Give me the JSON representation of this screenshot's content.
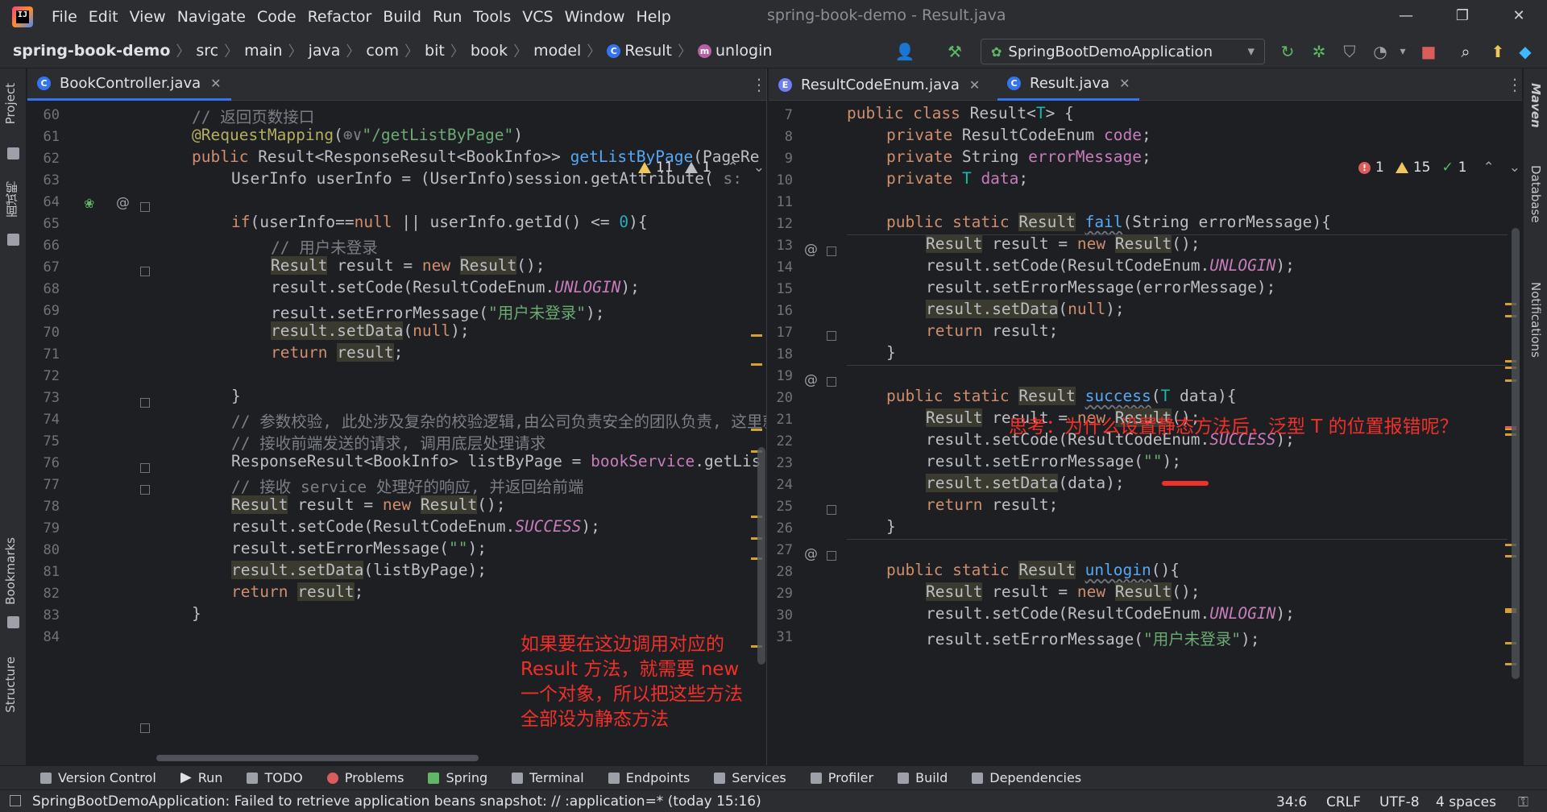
{
  "menu": [
    "File",
    "Edit",
    "View",
    "Navigate",
    "Code",
    "Refactor",
    "Build",
    "Run",
    "Tools",
    "VCS",
    "Window",
    "Help"
  ],
  "window_title": "spring-book-demo - Result.java",
  "breadcrumb": [
    "spring-book-demo",
    "src",
    "main",
    "java",
    "com",
    "bit",
    "book",
    "model",
    "Result",
    "unlogin"
  ],
  "run_config": "SpringBootDemoApplication",
  "left_tools": {
    "project": "Project",
    "mianshiya": "面试鸭",
    "bookmarks": "Bookmarks",
    "structure": "Structure"
  },
  "right_tools": {
    "maven": "Maven",
    "database": "Database",
    "notifications": "Notifications"
  },
  "left_pane": {
    "tab": "BookController.java",
    "inspections": {
      "warnings": "11",
      "weak": "1"
    },
    "lines": [
      {
        "n": "60",
        "html": "<span class='cmt'>// 返回页数接口</span>",
        "indent": 0
      },
      {
        "n": "61",
        "html": "<span class='ann'>@RequestMapping</span>(<span class='cmt'>⊕∨</span><span class='str'>\"/getListByPage\"</span>)",
        "indent": 0
      },
      {
        "n": "62",
        "html": "<span class='kw'>public</span> Result&lt;ResponseResult&lt;BookInfo&gt;&gt; <span class='fn'>getListByPage</span>(PageRe",
        "indent": 0
      },
      {
        "n": "63",
        "html": "UserInfo userInfo = (UserInfo)session.getAttribute( <span class='cmt'>s:</span>",
        "indent": 1
      },
      {
        "n": "64",
        "html": "",
        "indent": 1
      },
      {
        "n": "65",
        "html": "<span class='kw'>if</span>(userInfo==<span class='kw'>null</span> || userInfo.getId() &lt;= <span class='num'>0</span>){",
        "indent": 1
      },
      {
        "n": "66",
        "html": "<span class='cmt'>// 用户未登录</span>",
        "indent": 2
      },
      {
        "n": "67",
        "html": "<span class='hl'>Result</span> result = <span class='kw'>new</span> <span class='hl'>Result</span>();",
        "indent": 2
      },
      {
        "n": "68",
        "html": "result.setCode(ResultCodeEnum.<span class='const'>UNLOGIN</span>);",
        "indent": 2
      },
      {
        "n": "69",
        "html": "result.setErrorMessage(<span class='str'>\"用户未登录\"</span>);",
        "indent": 2
      },
      {
        "n": "70",
        "html": "<span class='hl'>result.setData</span>(<span class='kw'>null</span>);",
        "indent": 2
      },
      {
        "n": "71",
        "html": "<span class='kw'>return</span> <span class='hl'>result</span>;",
        "indent": 2
      },
      {
        "n": "72",
        "html": "",
        "indent": 2
      },
      {
        "n": "73",
        "html": "}",
        "indent": 1
      },
      {
        "n": "74",
        "html": "<span class='cmt'>// 参数校验, 此处涉及复杂的校验逻辑,由公司负责安全的团队负责, 这里就</span>",
        "indent": 1
      },
      {
        "n": "75",
        "html": "<span class='cmt'>// 接收前端发送的请求, 调用底层处理请求</span>",
        "indent": 1
      },
      {
        "n": "76",
        "html": "ResponseResult&lt;BookInfo&gt; listByPage = <span class='field'>bookService</span>.getLis",
        "indent": 1
      },
      {
        "n": "77",
        "html": "<span class='cmt'>// 接收 service 处理好的响应, 并返回给前端</span>",
        "indent": 1
      },
      {
        "n": "78",
        "html": "<span class='hl'>Result</span> result = <span class='kw'>new</span> <span class='hl'>Result</span>();",
        "indent": 1
      },
      {
        "n": "79",
        "html": "result.setCode(ResultCodeEnum.<span class='const'>SUCCESS</span>);",
        "indent": 1
      },
      {
        "n": "80",
        "html": "result.setErrorMessage(<span class='str'>\"\"</span>);",
        "indent": 1
      },
      {
        "n": "81",
        "html": "<span class='hl'>result.setData</span>(listByPage);",
        "indent": 1
      },
      {
        "n": "82",
        "html": "<span class='kw'>return</span> <span class='hl'>result</span>;",
        "indent": 1
      },
      {
        "n": "83",
        "html": "}",
        "indent": 0
      },
      {
        "n": "84",
        "html": "",
        "indent": 0
      }
    ],
    "annotation": "如果要在这边调用对应的\nResult 方法，就需要 new\n一个对象，所以把这些方法\n全部设为静态方法"
  },
  "right_pane": {
    "tabs": [
      "ResultCodeEnum.java",
      "Result.java"
    ],
    "inspections": {
      "errors": "1",
      "warnings": "15",
      "ok": "1"
    },
    "lines": [
      {
        "n": "7",
        "html": "<span class='kw'>public class</span> Result&lt;<span class='tparam'>T</span>&gt; {",
        "indent": 0
      },
      {
        "n": "8",
        "html": "<span class='kw'>private</span> ResultCodeEnum <span class='field'>code</span>;",
        "indent": 1
      },
      {
        "n": "9",
        "html": "<span class='kw'>private</span> String <span class='field'>errorMessage</span>;",
        "indent": 1
      },
      {
        "n": "10",
        "html": "<span class='kw'>private</span> <span class='tparam'>T</span> <span class='field'>data</span>;",
        "indent": 1
      },
      {
        "n": "11",
        "html": "",
        "indent": 1
      },
      {
        "n": "12",
        "html": "<span class='kw'>public static</span> <span class='hl'>Result</span> <span class='fn underline-wavy'>fail</span>(String errorMessage){",
        "indent": 1
      },
      {
        "n": "13",
        "html": "<span class='hl'>Result</span> result = <span class='kw'>new</span> <span class='hl'>Result</span>();",
        "indent": 2
      },
      {
        "n": "14",
        "html": "result.setCode(ResultCodeEnum.<span class='const'>UNLOGIN</span>);",
        "indent": 2
      },
      {
        "n": "15",
        "html": "result.setErrorMessage(errorMessage);",
        "indent": 2
      },
      {
        "n": "16",
        "html": "<span class='hl'>result.setData</span>(<span class='kw'>null</span>);",
        "indent": 2
      },
      {
        "n": "17",
        "html": "<span class='kw'>return</span> result;",
        "indent": 2
      },
      {
        "n": "18",
        "html": "}",
        "indent": 1
      },
      {
        "n": "19",
        "html": "",
        "indent": 1
      },
      {
        "n": "20",
        "html": "<span class='kw'>public static</span> <span class='hl'>Result</span> <span class='fn underline-wavy'>success</span>(<span class='tparam'>T</span> data){",
        "indent": 1
      },
      {
        "n": "21",
        "html": "<span class='hl'>Result</span> result = <span class='kw'>new</span> <span class='hl'>Result</span>();",
        "indent": 2
      },
      {
        "n": "22",
        "html": "result.setCode(ResultCodeEnum.<span class='const'>SUCCESS</span>);",
        "indent": 2
      },
      {
        "n": "23",
        "html": "result.setErrorMessage(<span class='str'>\"\"</span>);",
        "indent": 2
      },
      {
        "n": "24",
        "html": "<span class='hl'>result.setData</span>(data);",
        "indent": 2
      },
      {
        "n": "25",
        "html": "<span class='kw'>return</span> result;",
        "indent": 2
      },
      {
        "n": "26",
        "html": "}",
        "indent": 1
      },
      {
        "n": "27",
        "html": "",
        "indent": 1
      },
      {
        "n": "28",
        "html": "<span class='kw'>public static</span> <span class='hl'>Result</span> <span class='fn underline-wavy'>unlogin</span>(){",
        "indent": 1
      },
      {
        "n": "29",
        "html": "<span class='hl'>Result</span> result = <span class='kw'>new</span> <span class='hl'>Result</span>();",
        "indent": 2
      },
      {
        "n": "30",
        "html": "result.setCode(ResultCodeEnum.<span class='const'>UNLOGIN</span>);",
        "indent": 2
      },
      {
        "n": "31",
        "html": "result.setErrorMessage(<span class='str'>\"用户未登录\"</span>);",
        "indent": 2
      }
    ],
    "annotation": "思考：为什么设置静态方法后，泛型 T 的位置报错呢？"
  },
  "bottom_tools": [
    "Version Control",
    "Run",
    "TODO",
    "Problems",
    "Spring",
    "Terminal",
    "Endpoints",
    "Services",
    "Profiler",
    "Build",
    "Dependencies"
  ],
  "status": {
    "message": "SpringBootDemoApplication: Failed to retrieve application beans snapshot: // :application=* (today 15:16)",
    "position": "34:6",
    "line_sep": "CRLF",
    "encoding": "UTF-8",
    "indent": "4 spaces"
  },
  "colors": {
    "accent": "#3574f0",
    "annotation": "#f0302a",
    "warning": "#f2c55c"
  }
}
